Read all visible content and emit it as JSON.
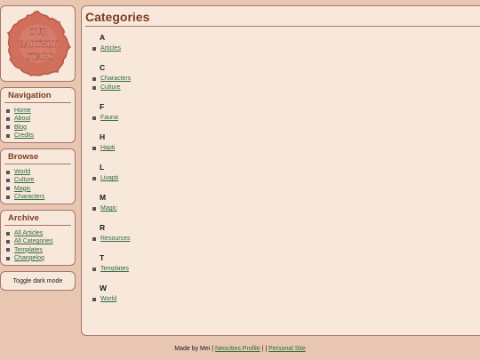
{
  "logo": {
    "line1": "OUR",
    "line2": "EARTHLY",
    "line3": "STARS",
    "color": "#cf6f5c"
  },
  "sidebar": {
    "navigation": {
      "title": "Navigation",
      "items": [
        "Home",
        "About",
        "Blog",
        "Credits"
      ]
    },
    "browse": {
      "title": "Browse",
      "items": [
        "World",
        "Culture",
        "Magic",
        "Characters"
      ]
    },
    "archive": {
      "title": "Archive",
      "items": [
        "All Articles",
        "All Categories",
        "Templates",
        "Changelog"
      ]
    },
    "toggle_label": "Toggle dark mode"
  },
  "main": {
    "title": "Categories",
    "groups": [
      {
        "letter": "A",
        "items": [
          "Articles"
        ]
      },
      {
        "letter": "C",
        "items": [
          "Characters",
          "Culture"
        ]
      },
      {
        "letter": "F",
        "items": [
          "Fauna"
        ]
      },
      {
        "letter": "H",
        "items": [
          "Hapti"
        ]
      },
      {
        "letter": "L",
        "items": [
          "Livapti"
        ]
      },
      {
        "letter": "M",
        "items": [
          "Magic"
        ]
      },
      {
        "letter": "R",
        "items": [
          "Resources"
        ]
      },
      {
        "letter": "T",
        "items": [
          "Templates"
        ]
      },
      {
        "letter": "W",
        "items": [
          "World"
        ]
      }
    ]
  },
  "footer": {
    "made_by": "Made by Mei",
    "sep1": "|",
    "neocities": "Neocities Profile",
    "sep2": "| |",
    "personal": "Personal Site"
  },
  "colors": {
    "background": "#e9c6b2",
    "panel": "#f8e8dc",
    "border": "#a4766a",
    "heading": "#7a3d1f",
    "link": "#2e6b3e"
  }
}
